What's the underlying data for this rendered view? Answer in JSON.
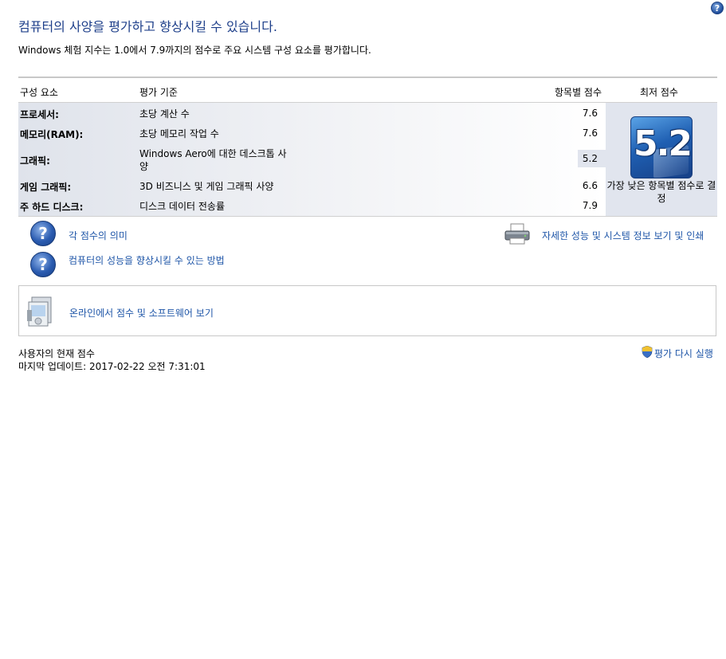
{
  "header": {
    "help_icon": "?",
    "title": "컴퓨터의 사양을 평가하고 향상시킬 수 있습니다.",
    "subtitle": "Windows 체험 지수는 1.0에서 7.9까지의 점수로 주요 시스템 구성 요소를 평가합니다."
  },
  "table": {
    "headers": {
      "component": "구성 요소",
      "criteria": "평가 기준",
      "subscore": "항목별 점수",
      "base": "최저 점수"
    },
    "rows": [
      {
        "component": "프로세서:",
        "criteria": "초당 계산 수",
        "subscore": "7.6"
      },
      {
        "component": "메모리(RAM):",
        "criteria": "초당 메모리 작업 수",
        "subscore": "7.6"
      },
      {
        "component": "그래픽:",
        "criteria": "Windows Aero에 대한 데스크톱 사양",
        "subscore": "5.2"
      },
      {
        "component": "게임 그래픽:",
        "criteria": "3D 비즈니스 및 게임 그래픽 사양",
        "subscore": "6.6"
      },
      {
        "component": "주 하드 디스크:",
        "criteria": "디스크 데이터 전송률",
        "subscore": "7.9"
      }
    ],
    "base_score": "5.2",
    "base_caption": "가장 낮은 항목별 점수로 결정"
  },
  "links": {
    "meaning": "각 점수의 의미",
    "improve": "컴퓨터의 성능을 향상시킬 수 있는 방법",
    "details": "자세한 성능 및 시스템 정보 보기 및 인쇄",
    "online": "온라인에서 점수 및 소프트웨어 보기",
    "rerun": "평가 다시 실행"
  },
  "icons": {
    "question": "?",
    "help": "help-icon",
    "printer": "printer-icon",
    "package": "software-box-icon",
    "shield": "uac-shield-icon"
  },
  "footer": {
    "current": "사용자의 현재 점수",
    "updated": "마지막 업데이트: 2017-02-22 오전 7:31:01"
  },
  "colors": {
    "link": "#1f56a8",
    "title": "#1e3f8a",
    "badge": "#1f5fb2"
  }
}
